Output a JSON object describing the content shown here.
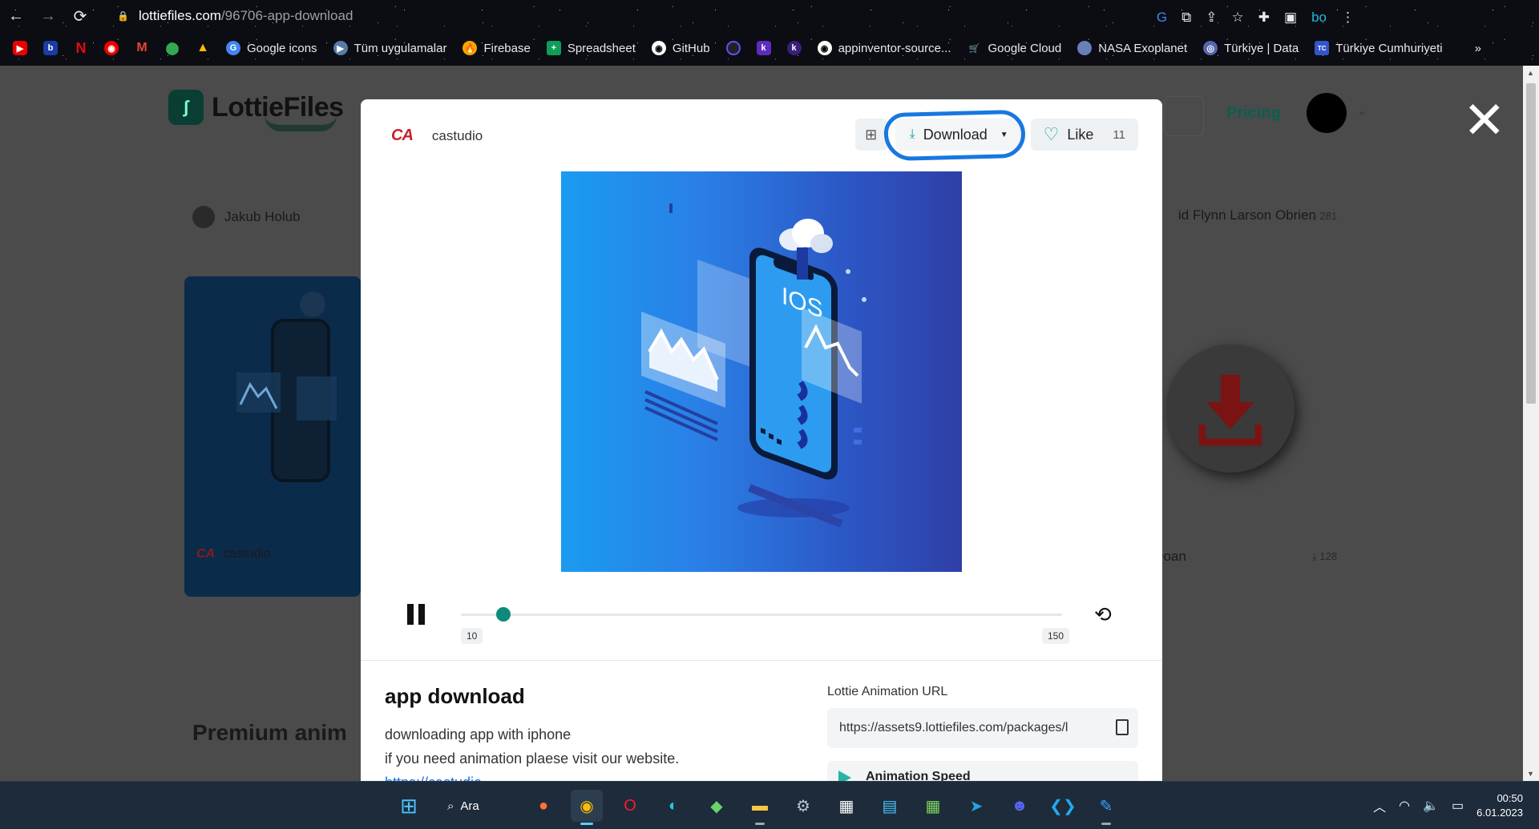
{
  "browser": {
    "url_host": "lottiefiles.com",
    "url_path": "/96706-app-download",
    "bookmarks": [
      {
        "label": "Google icons",
        "color": "#4285f4"
      },
      {
        "label": "Tüm uygulamalar",
        "color": "#5a7aa8"
      },
      {
        "label": "Firebase",
        "color": "#f6a500"
      },
      {
        "label": "Spreadsheet",
        "color": "#0f9d58"
      },
      {
        "label": "GitHub",
        "color": "#ffffff"
      },
      {
        "label": "appinventor-source...",
        "color": "#ffffff"
      },
      {
        "label": "Google Cloud",
        "color": "#4285f4"
      },
      {
        "label": "NASA Exoplanet",
        "color": "#1d3b8a"
      },
      {
        "label": "Türkiye | Data",
        "color": "#5566aa"
      },
      {
        "label": "Türkiye Cumhuriyeti",
        "color": "#3355cc"
      }
    ],
    "more": "»"
  },
  "page": {
    "logo": "LottieFiles",
    "pricing": "Pricing",
    "bg_user_1": "Jakub Holub",
    "bg_user_2": "castudio",
    "bg_user_3": "id Flynn Larson Obrien",
    "bg_user_3_dl": "281",
    "bg_user_4": "n Doan",
    "bg_user_4_dl": "128",
    "premium": "Premium anim"
  },
  "modal": {
    "author": "castudio",
    "author_logo": "CA",
    "download_label": "Download",
    "like_label": "Like",
    "like_count": "11",
    "frame_start": "10",
    "frame_end": "150",
    "progress_fraction": 0.07,
    "title": "app download",
    "desc_line1": "downloading app with iphone",
    "desc_line2": "if you need animation plaese visit our website.",
    "link": "https://castudio...",
    "url_label": "Lottie Animation URL",
    "url_value": "https://assets9.lottiefiles.com/packages/l",
    "speed_label": "Animation Speed",
    "phone_text": "IOS"
  },
  "taskbar": {
    "search": "Ara",
    "time": "00:50",
    "date": "6.01.2023"
  }
}
